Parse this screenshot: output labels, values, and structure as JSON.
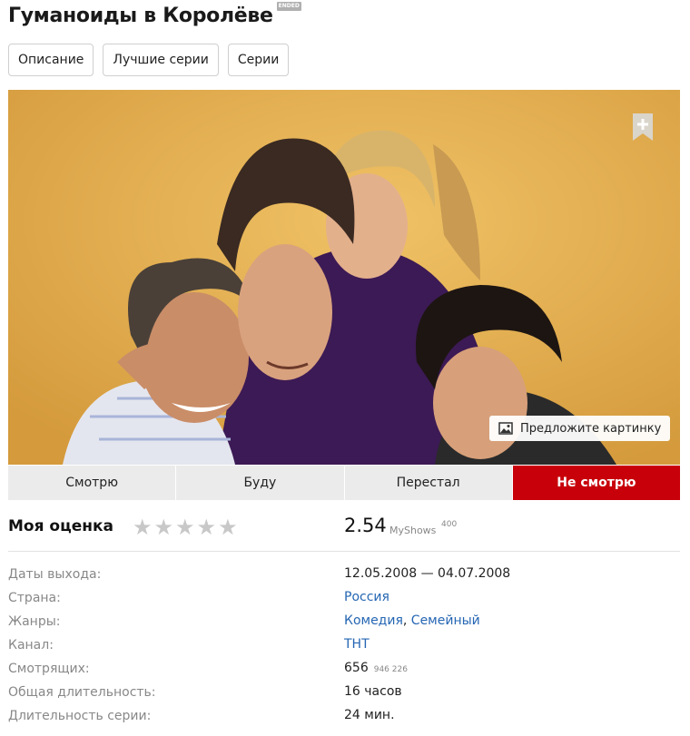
{
  "header": {
    "title": "Гуманоиды в Королёве",
    "badge": "ENDED"
  },
  "tabs": [
    "Описание",
    "Лучшие серии",
    "Серии"
  ],
  "hero": {
    "suggest_label": "Предложите картинку"
  },
  "status_buttons": [
    "Смотрю",
    "Буду",
    "Перестал",
    "Не смотрю"
  ],
  "rating": {
    "label": "Моя оценка",
    "stars": [
      "★",
      "★",
      "★",
      "★",
      "★"
    ],
    "score": "2.54",
    "source": "MyShows",
    "votes": "400"
  },
  "info": {
    "dates_label": "Даты выхода:",
    "dates_value": "12.05.2008 — 04.07.2008",
    "country_label": "Страна:",
    "country_value": "Россия",
    "genres_label": "Жанры:",
    "genre_1": "Комедия",
    "genre_sep": ",",
    "genre_2": "Семейный",
    "channel_label": "Канал:",
    "channel_value": "ТНТ",
    "watchers_label": "Смотрящих:",
    "watchers_value": "656",
    "watchers_total": "946 226",
    "total_length_label": "Общая длительность:",
    "total_length_value": "16 часов",
    "episode_length_label": "Длительность серии:",
    "episode_length_value": "24 мин."
  },
  "colors": {
    "accent": "#c8000a",
    "link": "#2566b3",
    "hero_bg": "#e0a94a"
  },
  "icons": {
    "bookmark": "bookmark-plus-icon",
    "image": "image-icon"
  }
}
